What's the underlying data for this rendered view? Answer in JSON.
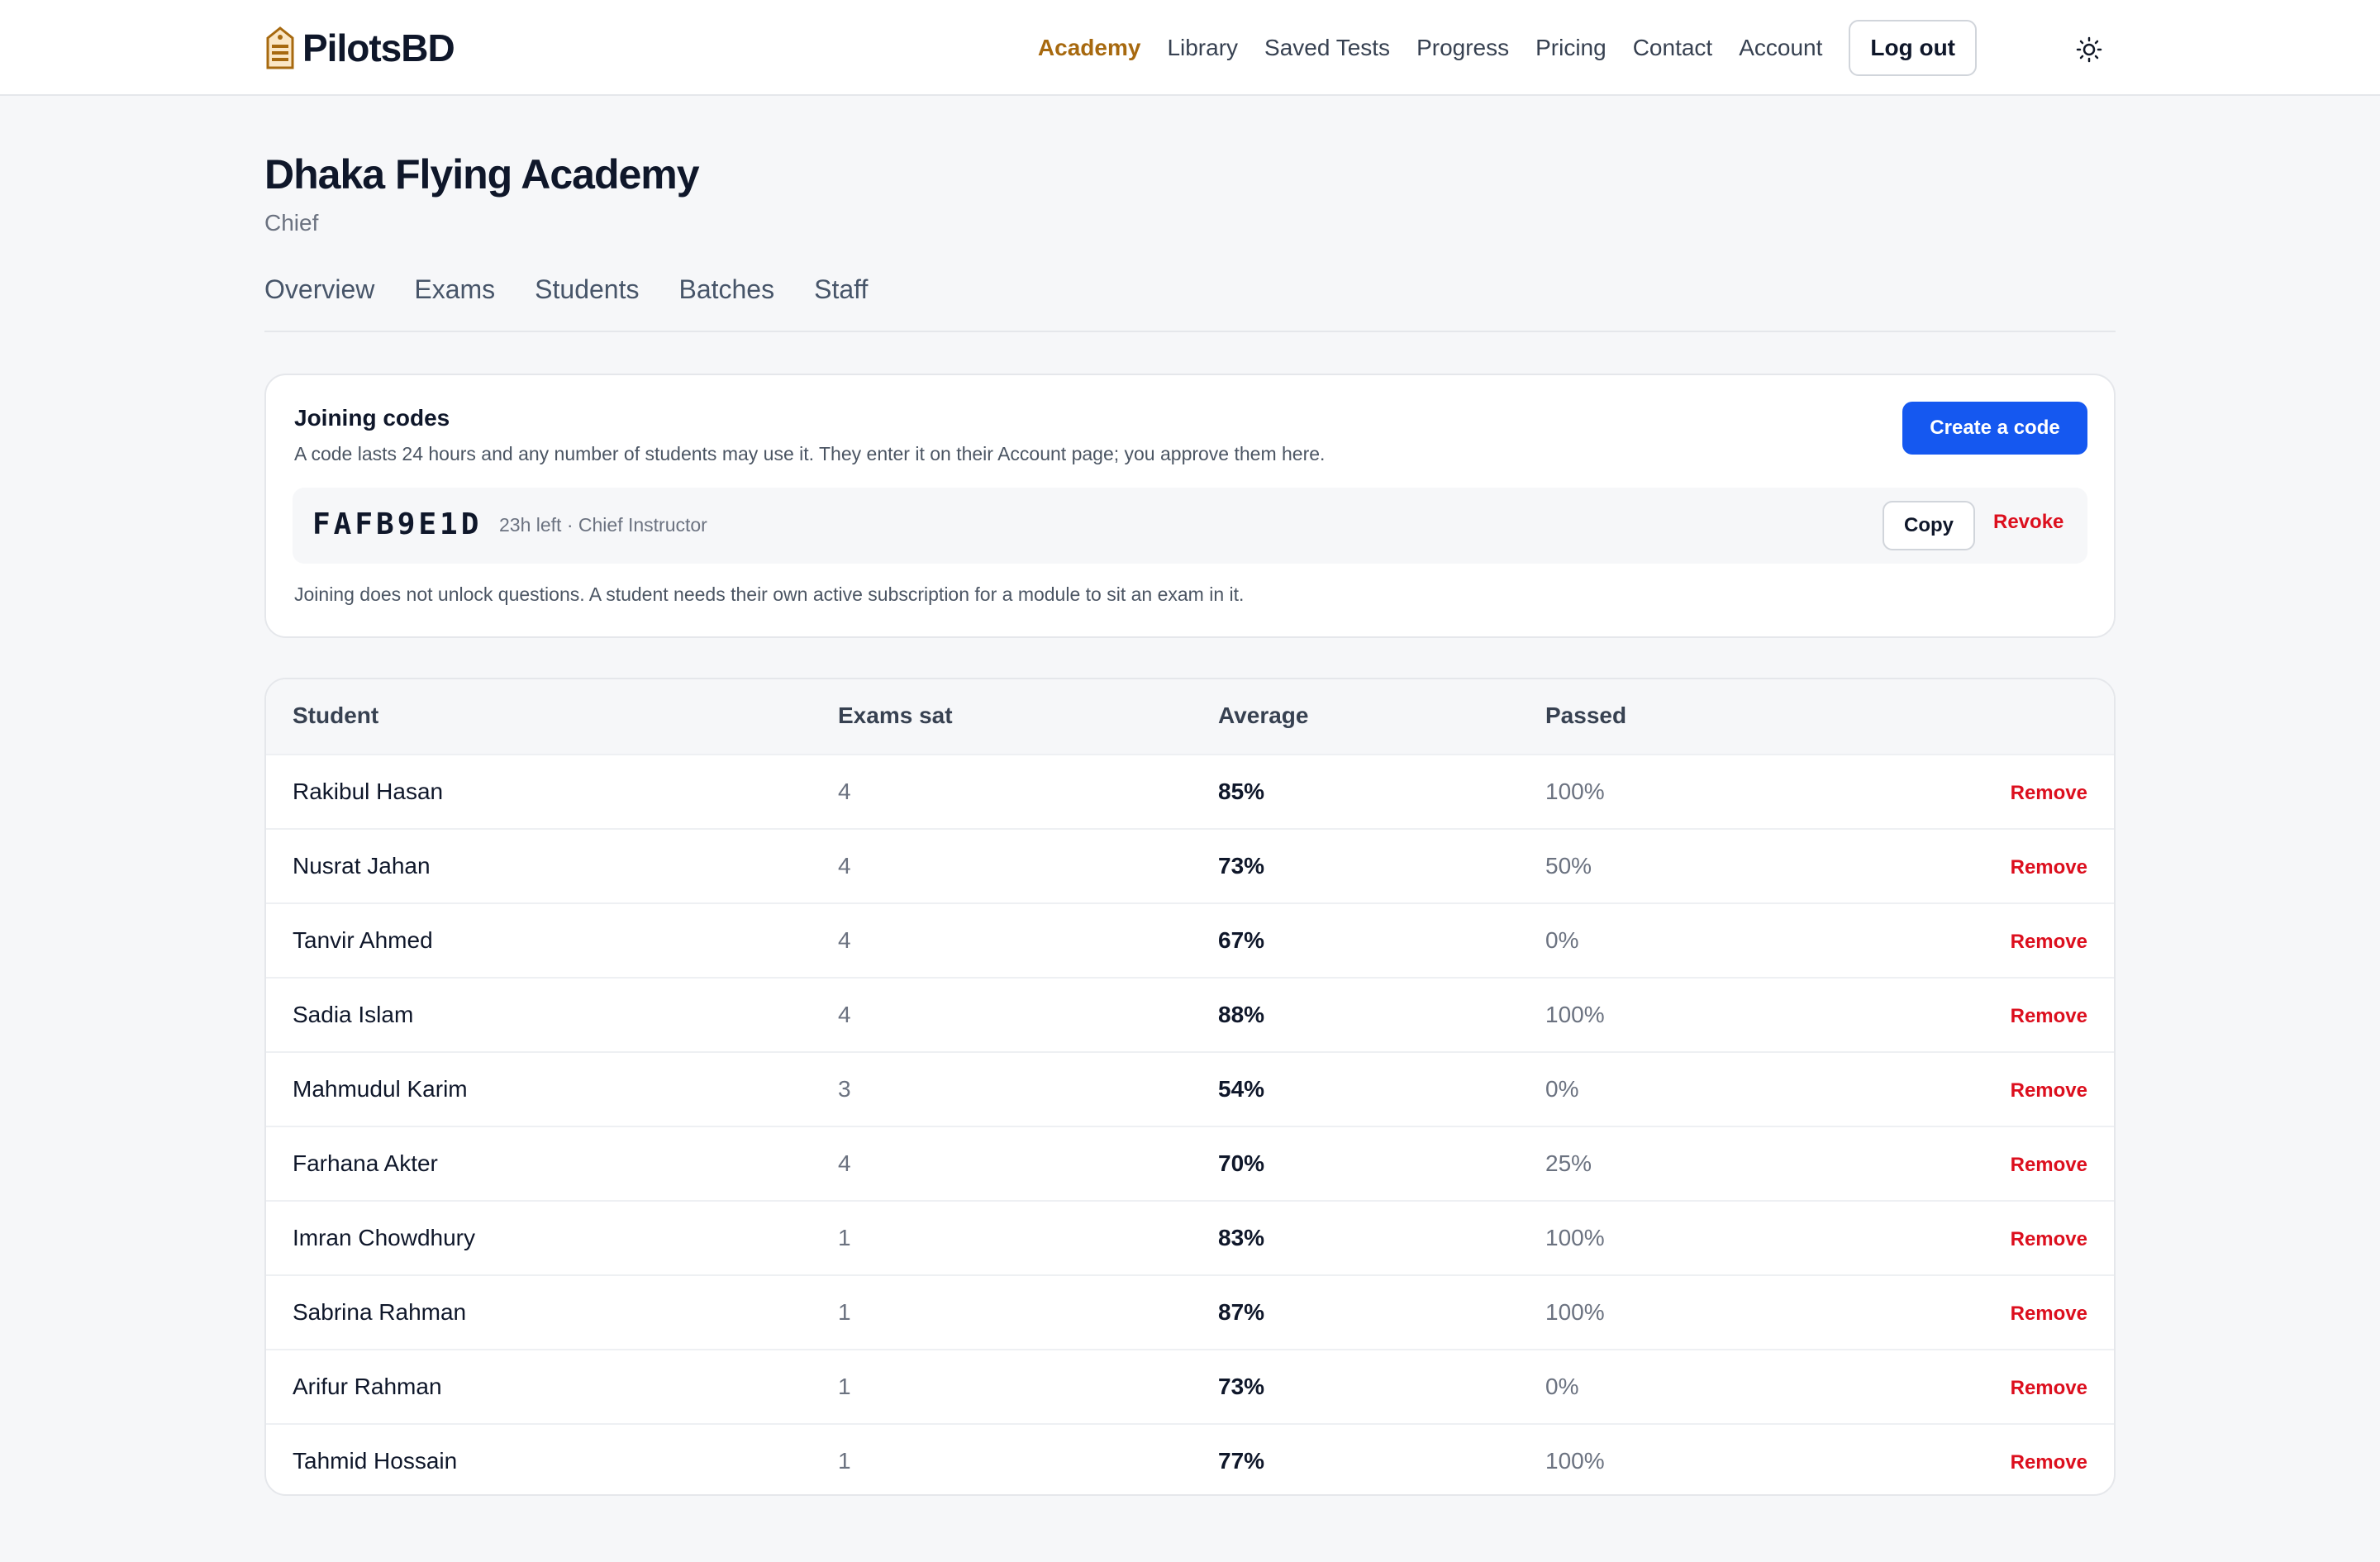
{
  "header": {
    "brand": "PilotsBD",
    "nav": [
      "Academy",
      "Library",
      "Saved Tests",
      "Progress",
      "Pricing",
      "Contact",
      "Account"
    ],
    "active_nav": "Academy",
    "logout_label": "Log out",
    "theme_icon": "sun-icon"
  },
  "page": {
    "title": "Dhaka Flying Academy",
    "subtitle": "Chief",
    "tabs": [
      "Overview",
      "Exams",
      "Students",
      "Batches",
      "Staff"
    ]
  },
  "joining_codes": {
    "title": "Joining codes",
    "description": "A code lasts 24 hours and any number of students may use it. They enter it on their Account page; you approve them here.",
    "create_label": "Create a code",
    "code": "FAFB9E1D",
    "code_meta": "23h left · Chief Instructor",
    "copy_label": "Copy",
    "revoke_label": "Revoke",
    "note": "Joining does not unlock questions. A student needs their own active subscription for a module to sit an exam in it."
  },
  "students_table": {
    "columns": [
      "Student",
      "Exams sat",
      "Average",
      "Passed"
    ],
    "remove_label": "Remove",
    "rows": [
      {
        "name": "Rakibul Hasan",
        "exams": "4",
        "average": "85%",
        "passed": "100%"
      },
      {
        "name": "Nusrat Jahan",
        "exams": "4",
        "average": "73%",
        "passed": "50%"
      },
      {
        "name": "Tanvir Ahmed",
        "exams": "4",
        "average": "67%",
        "passed": "0%"
      },
      {
        "name": "Sadia Islam",
        "exams": "4",
        "average": "88%",
        "passed": "100%"
      },
      {
        "name": "Mahmudul Karim",
        "exams": "3",
        "average": "54%",
        "passed": "0%"
      },
      {
        "name": "Farhana Akter",
        "exams": "4",
        "average": "70%",
        "passed": "25%"
      },
      {
        "name": "Imran Chowdhury",
        "exams": "1",
        "average": "83%",
        "passed": "100%"
      },
      {
        "name": "Sabrina Rahman",
        "exams": "1",
        "average": "87%",
        "passed": "100%"
      },
      {
        "name": "Arifur Rahman",
        "exams": "1",
        "average": "73%",
        "passed": "0%"
      },
      {
        "name": "Tahmid Hossain",
        "exams": "1",
        "average": "77%",
        "passed": "100%"
      }
    ]
  },
  "colors": {
    "accent": "#a7690f",
    "primary_button": "#1558f0",
    "danger": "#dc0f1e"
  }
}
